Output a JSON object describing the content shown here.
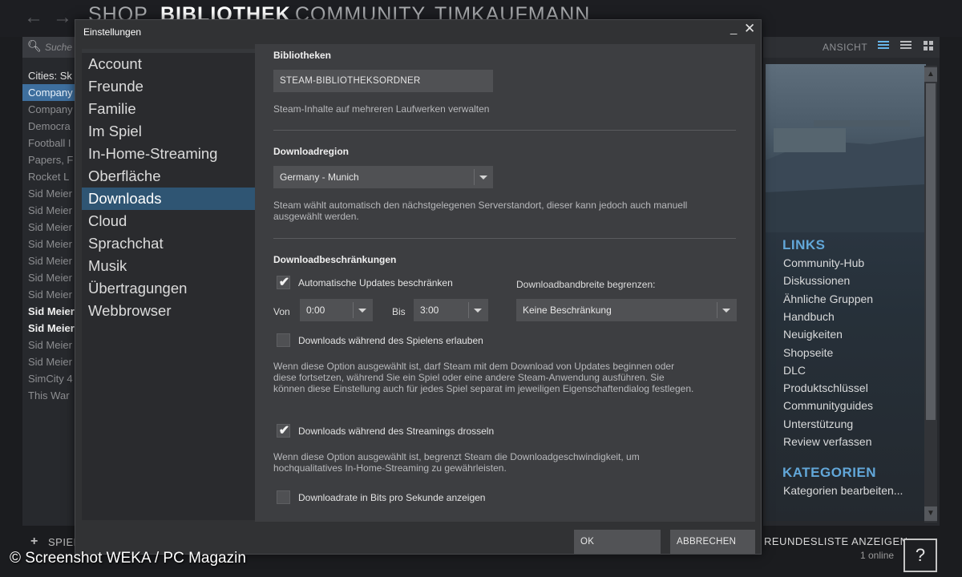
{
  "client": {
    "nav": {
      "shop": "SHOP",
      "library": "BIBLIOTHEK",
      "community": "COMMUNITY",
      "user": "TIMKAUFMANN"
    },
    "search_placeholder": "Suche",
    "games": [
      {
        "label": "Cities: Sk",
        "style": "head"
      },
      {
        "label": "Company",
        "style": "selected"
      },
      {
        "label": "Company",
        "style": ""
      },
      {
        "label": "Democra",
        "style": ""
      },
      {
        "label": "Football I",
        "style": ""
      },
      {
        "label": "Papers, F",
        "style": ""
      },
      {
        "label": "Rocket L",
        "style": ""
      },
      {
        "label": "Sid Meier",
        "style": ""
      },
      {
        "label": "Sid Meier",
        "style": ""
      },
      {
        "label": "Sid Meier",
        "style": ""
      },
      {
        "label": "Sid Meier",
        "style": ""
      },
      {
        "label": "Sid Meier",
        "style": ""
      },
      {
        "label": "Sid Meier",
        "style": ""
      },
      {
        "label": "Sid Meier",
        "style": ""
      },
      {
        "label": "Sid Meier",
        "style": "bold"
      },
      {
        "label": "Sid Meier",
        "style": "bold"
      },
      {
        "label": "Sid Meier",
        "style": ""
      },
      {
        "label": "Sid Meier",
        "style": ""
      },
      {
        "label": "SimCity 4",
        "style": ""
      },
      {
        "label": "This War",
        "style": ""
      }
    ],
    "view_label": "ANSICHT",
    "links_title": "LINKS",
    "links": [
      "Community-Hub",
      "Diskussionen",
      "Ähnliche Gruppen",
      "Handbuch",
      "Neuigkeiten",
      "Shopseite",
      "DLC",
      "Produktschlüssel",
      "Communityguides",
      "Unterstützung",
      "Review verfassen"
    ],
    "categories_title": "KATEGORIEN",
    "categories_edit": "Kategorien bearbeiten...",
    "add_game": "SPIEL",
    "friends_list": "REUNDESLISTE ANZEIGEN",
    "online": "1 online",
    "help": "?"
  },
  "watermark": "© Screenshot WEKA / PC Magazin",
  "dialog": {
    "title": "Einstellungen",
    "minimize": "_",
    "close": "✕",
    "sidebar": [
      "Account",
      "Freunde",
      "Familie",
      "Im Spiel",
      "In-Home-Streaming",
      "Oberfläche",
      "Downloads",
      "Cloud",
      "Sprachchat",
      "Musik",
      "Übertragungen",
      "Webbrowser"
    ],
    "active_item": "Downloads",
    "libraries": {
      "heading": "Bibliotheken",
      "button": "STEAM-BIBLIOTHEKSORDNER",
      "desc": "Steam-Inhalte auf mehreren Laufwerken verwalten"
    },
    "region": {
      "heading": "Downloadregion",
      "value": "Germany - Munich",
      "desc": "Steam wählt automatisch den nächstgelegenen Serverstandort, dieser kann jedoch auch manuell ausgewählt werden."
    },
    "restrictions": {
      "heading": "Downloadbeschränkungen",
      "auto_updates_label": "Automatische Updates beschränken",
      "auto_updates_checked": true,
      "from_label": "Von",
      "from_value": "0:00",
      "to_label": "Bis",
      "to_value": "3:00",
      "bandwidth_label": "Downloadbandbreite begrenzen:",
      "bandwidth_value": "Keine Beschränkung",
      "during_play_label": "Downloads während des Spielens erlauben",
      "during_play_checked": false,
      "during_play_desc": "Wenn diese Option ausgewählt ist, darf Steam mit dem Download von Updates beginnen oder diese fortsetzen, während Sie ein Spiel oder eine andere Steam-Anwendung ausführen. Sie können diese Einstellung auch für jedes Spiel separat im jeweiligen Eigenschaftendialog festlegen.",
      "throttle_label": "Downloads während des Streamings drosseln",
      "throttle_checked": true,
      "throttle_desc": "Wenn diese Option ausgewählt ist, begrenzt Steam die Downloadgeschwindigkeit, um hochqualitatives In-Home-Streaming zu gewährleisten.",
      "bits_label": "Downloadrate in Bits pro Sekunde anzeigen",
      "bits_checked": false
    },
    "ok": "OK",
    "cancel": "ABBRECHEN"
  }
}
